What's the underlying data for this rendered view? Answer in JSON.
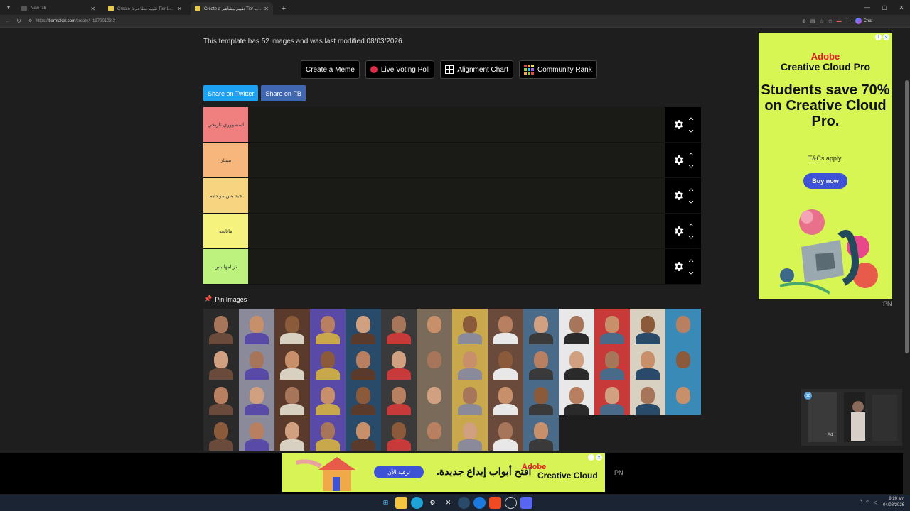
{
  "browser": {
    "tabs": [
      {
        "label": "New tab",
        "state": "inactive"
      },
      {
        "label": "Create a تقييم مطاعم Tier List - Ti",
        "state": "inactive"
      },
      {
        "label": "Create a تقييم مشاهير Tier List - Ti",
        "state": "active"
      }
    ],
    "new_tab_symbol": "+",
    "url_host": "tiermaker.com",
    "url_path": "/create/--19700103-3",
    "chat_label": "Chat"
  },
  "page": {
    "info_text": "This template has 52 images and was last modified 08/03/2026.",
    "action_buttons": [
      "Create a Meme",
      "Live Voting Poll",
      "Alignment Chart",
      "Community Rank"
    ],
    "share_buttons": [
      "Share on Twitter",
      "Share on FB"
    ],
    "tiers": [
      {
        "label": "اسطووري تاريخي",
        "color": "#f08080"
      },
      {
        "label": "ممتاز",
        "color": "#f7b67c"
      },
      {
        "label": "جيد بس مو دايم",
        "color": "#f7d480"
      },
      {
        "label": "ماتابعه",
        "color": "#f5f27d"
      },
      {
        "label": "تز امها بس",
        "color": "#bef27e"
      }
    ],
    "pin_label": "Pin Images"
  },
  "side_ad": {
    "brand_line1": "Adobe",
    "brand_line2": "Creative Cloud Pro",
    "headline": "Students save 70% on Creative Cloud Pro.",
    "terms": "T&Cs apply.",
    "cta": "Buy now",
    "marker": "PN",
    "bg_color": "#d7f553"
  },
  "video_ad": {
    "label": "Ad"
  },
  "bottom_ad": {
    "brand_line1": "Adobe",
    "brand_line2": "Creative Cloud",
    "text": "افتح أبواب إبداع جديدة.",
    "cta": "ترقية الآن",
    "marker": "PN"
  },
  "taskbar": {
    "time": "9:20 am",
    "date": "04/08/2026"
  }
}
